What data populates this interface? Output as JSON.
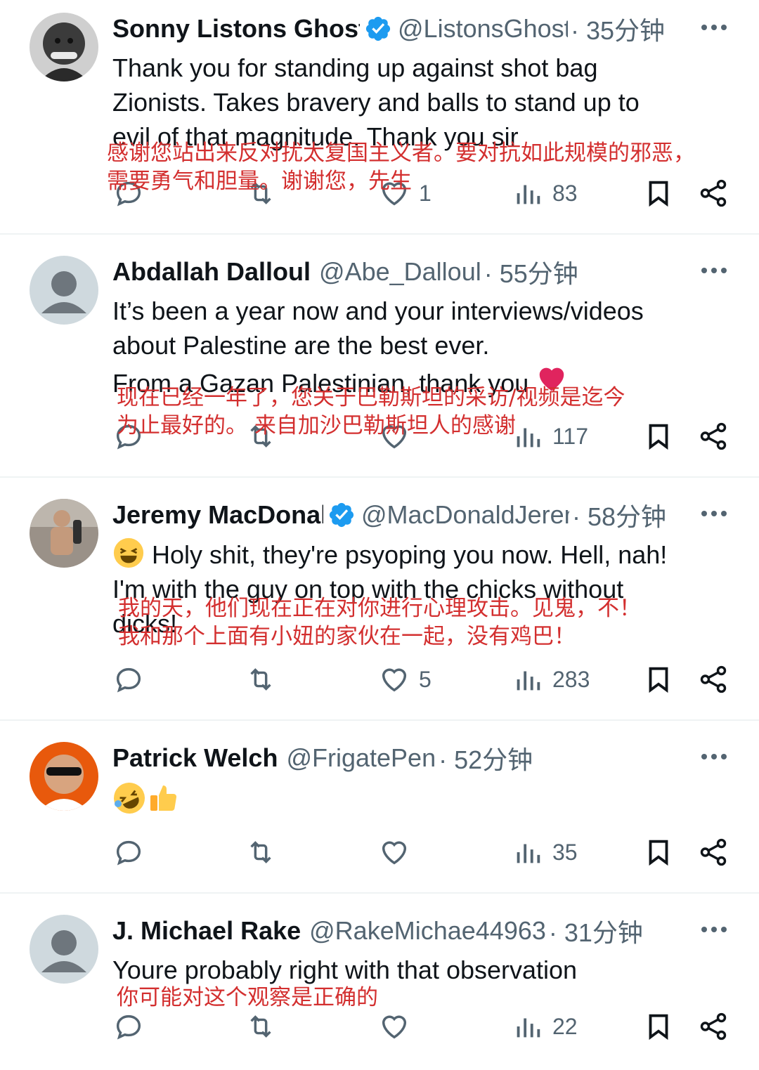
{
  "tweets": [
    {
      "name": "Sonny Listons Ghost",
      "handle": "@ListonsGhost",
      "time": "· 35分钟",
      "text": [
        "Thank you for standing up against shot bag",
        "Zionists. Takes bravery and balls to stand up to",
        "evil of that magnitude. Thank you sir"
      ],
      "translation": [
        "感谢您站出来反对扰太复国主义者。要对抗如此规模的邪恶，",
        "需要勇气和胆量。谢谢您，先生"
      ],
      "likes": "1",
      "views": "83"
    },
    {
      "name": "Abdallah Dalloul",
      "handle": "@Abe_Dalloul",
      "time": "· 55分钟",
      "text": [
        "It’s been a year now and your interviews/videos",
        "about Palestine are the best ever.",
        "From a Gazan Palestinian, thank you"
      ],
      "translation": [
        "现在已经一年了，您关于巴勒斯坦的采访/视频是迄今",
        "为止最好的。 来自加沙巴勒斯坦人的感谢"
      ],
      "likes": "",
      "views": "117"
    },
    {
      "name": "Jeremy MacDonald",
      "handle": "@MacDonaldJeremy",
      "time": "· 58分钟",
      "text": [
        "Holy shit, they're psyoping you now. Hell, nah!",
        "I'm with the guy on top with the chicks without",
        "dicks!"
      ],
      "translation": [
        "我的天，他们现在正在对你进行心理攻击。见鬼，不！",
        "我和那个上面有小妞的家伙在一起，没有鸡巴！"
      ],
      "likes": "5",
      "views": "283"
    },
    {
      "name": "Patrick Welch",
      "handle": "@FrigatePen",
      "time": "· 52分钟",
      "text": [],
      "translation": [],
      "likes": "",
      "views": "35"
    },
    {
      "name": "J. Michael Rake",
      "handle": "@RakeMichae44963",
      "time": "· 31分钟",
      "text": [
        "Youre probably right with that observation"
      ],
      "translation": [
        "你可能对这个观察是正确的"
      ],
      "likes": "",
      "views": "22"
    }
  ],
  "icons": {
    "reply": "reply-icon",
    "retweet": "retweet-icon",
    "like": "like-icon",
    "views": "views-icon",
    "bookmark": "bookmark-icon",
    "share": "share-icon",
    "more": "more-icon",
    "verified": "verified-badge-icon"
  },
  "colors": {
    "text": "#0f1419",
    "muted": "#536471",
    "verified": "#1d9bf0",
    "translation": "#d32f2f",
    "heart": "#e0245e"
  }
}
